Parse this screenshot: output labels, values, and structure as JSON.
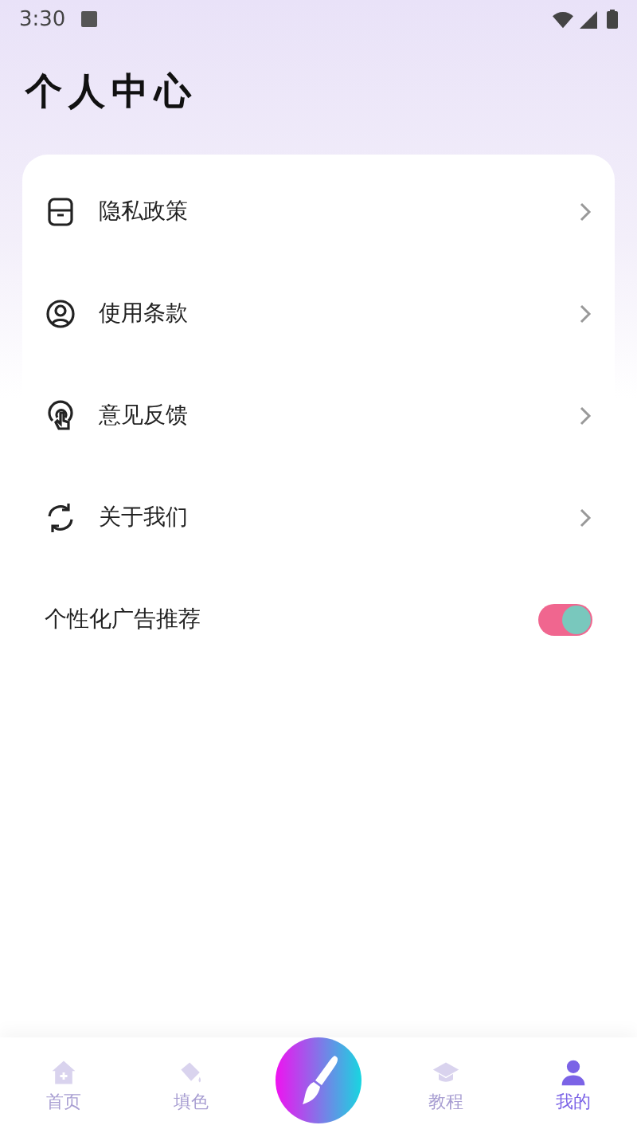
{
  "status_bar": {
    "time": "3:30"
  },
  "title": "个人中心",
  "menu": [
    {
      "kind": "link",
      "label": "隐私政策"
    },
    {
      "kind": "link",
      "label": "使用条款"
    },
    {
      "kind": "link",
      "label": "意见反馈"
    },
    {
      "kind": "link",
      "label": "关于我们"
    },
    {
      "kind": "toggle",
      "label": "个性化广告推荐",
      "on": true
    }
  ],
  "nav": [
    {
      "kind": "tab",
      "label": "首页",
      "selected": false
    },
    {
      "kind": "tab",
      "label": "填色",
      "selected": false
    },
    {
      "kind": "action"
    },
    {
      "kind": "tab",
      "label": "教程",
      "selected": false
    },
    {
      "kind": "tab",
      "label": "我的",
      "selected": true
    }
  ]
}
